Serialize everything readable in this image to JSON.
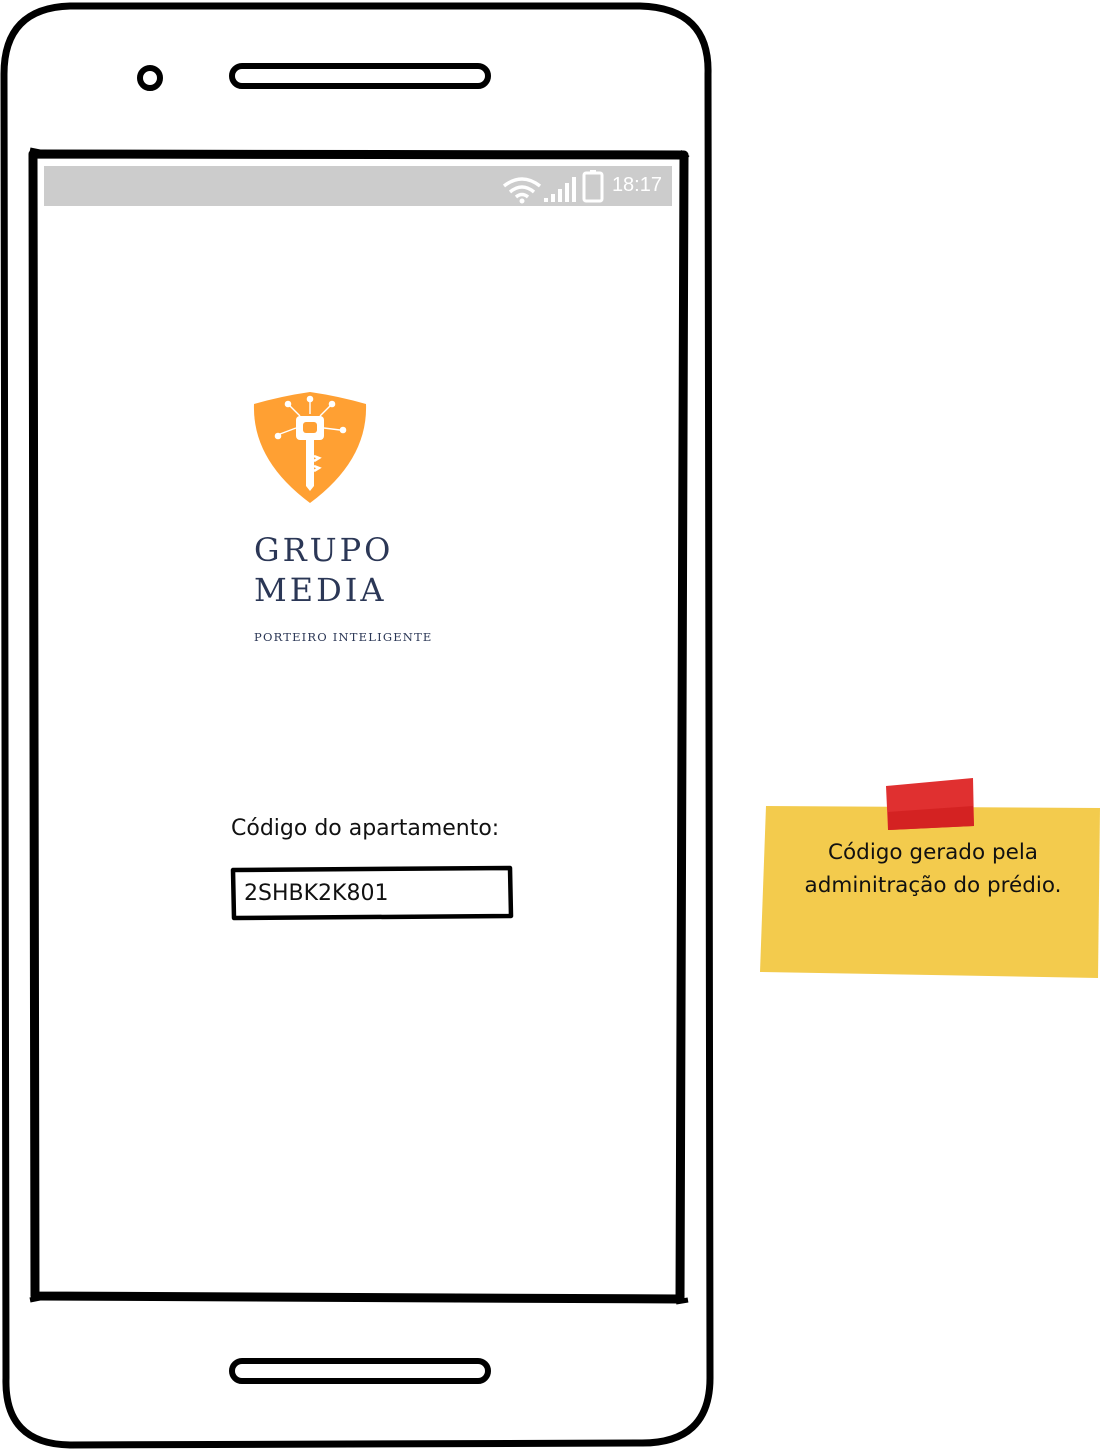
{
  "status_bar": {
    "time": "18:17",
    "icons": [
      "wifi-icon",
      "signal-icon",
      "battery-icon"
    ],
    "background": "#cccccc"
  },
  "brand": {
    "name_line1": "GRUPO",
    "name_line2": "MEDIA",
    "tagline": "PORTEIRO INTELIGENTE",
    "logo_color": "#ffa033",
    "text_color": "#2b3756"
  },
  "form": {
    "label": "Código do apartamento:",
    "code_value": "2SHBK2K801"
  },
  "sticky_note": {
    "text": "Código gerado pela adminitração do prédio.",
    "color": "#f3cb4d",
    "tape_color": "#e03030"
  }
}
